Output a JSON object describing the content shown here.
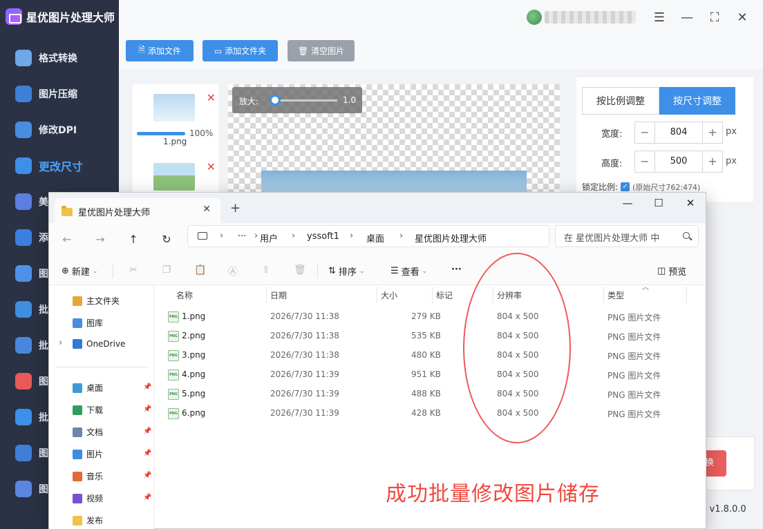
{
  "app": {
    "title": "星优图片处理大师",
    "version": "v1.8.0.0",
    "nav": [
      {
        "label": "格式转换",
        "color": "#6fa8e8"
      },
      {
        "label": "图片压缩",
        "color": "#3f7fd8"
      },
      {
        "label": "修改DPI",
        "color": "#4a8de0"
      },
      {
        "label": "更改尺寸",
        "color": "#3d8fe8"
      },
      {
        "label": "美",
        "color": "#5a7fe0"
      },
      {
        "label": "添",
        "color": "#3c7fe0"
      },
      {
        "label": "图",
        "color": "#4e92e8"
      },
      {
        "label": "批",
        "color": "#3f8fe0"
      },
      {
        "label": "批",
        "color": "#4a86df"
      },
      {
        "label": "图",
        "color": "#e85a5a"
      },
      {
        "label": "批",
        "color": "#3d8fe8"
      },
      {
        "label": "图",
        "color": "#3f7fd8"
      },
      {
        "label": "图",
        "color": "#5b86e0"
      }
    ],
    "toolbar": {
      "add_file": "添加文件",
      "add_folder": "添加文件夹",
      "clear": "清空图片"
    },
    "file_list": [
      {
        "name": "1.png",
        "progress_pct": 100,
        "progress_text": "100%"
      }
    ],
    "zoom": {
      "label": "放大:",
      "value": "1.0"
    },
    "settings": {
      "tab_ratio": "按比例调整",
      "tab_size": "按尺寸调整",
      "width_label": "宽度:",
      "width_value": "804",
      "height_label": "高度:",
      "height_value": "500",
      "unit": "px",
      "minus": "−",
      "plus": "+",
      "lock_label": "锁定比例:",
      "lock_hint": "(原始尺寸762:474)"
    },
    "convert_btn": "换",
    "version_prefix": ":"
  },
  "explorer": {
    "tab_title": "星优图片处理大师",
    "breadcrumb": [
      "用户",
      "yssoft1",
      "桌面",
      "星优图片处理大师"
    ],
    "search_placeholder": "在 星优图片处理大师 中",
    "commands": {
      "new": "新建",
      "sort": "排序",
      "view": "查看",
      "more": "···",
      "preview": "预览"
    },
    "nav": [
      {
        "label": "主文件夹",
        "pinned": false
      },
      {
        "label": "图库",
        "pinned": false
      },
      {
        "label": "OneDrive",
        "pinned": false
      },
      {
        "label": "桌面",
        "pinned": true
      },
      {
        "label": "下载",
        "pinned": true
      },
      {
        "label": "文档",
        "pinned": true
      },
      {
        "label": "图片",
        "pinned": true
      },
      {
        "label": "音乐",
        "pinned": true
      },
      {
        "label": "视频",
        "pinned": true
      },
      {
        "label": "发布",
        "pinned": false
      }
    ],
    "columns": [
      "名称",
      "日期",
      "大小",
      "标记",
      "分辨率",
      "类型"
    ],
    "files": [
      {
        "name": "1.png",
        "date": "2026/7/30 11:38",
        "size": "279 KB",
        "resolution": "804 x 500",
        "type": "PNG 图片文件"
      },
      {
        "name": "2.png",
        "date": "2026/7/30 11:38",
        "size": "535 KB",
        "resolution": "804 x 500",
        "type": "PNG 图片文件"
      },
      {
        "name": "3.png",
        "date": "2026/7/30 11:38",
        "size": "480 KB",
        "resolution": "804 x 500",
        "type": "PNG 图片文件"
      },
      {
        "name": "4.png",
        "date": "2026/7/30 11:39",
        "size": "951 KB",
        "resolution": "804 x 500",
        "type": "PNG 图片文件"
      },
      {
        "name": "5.png",
        "date": "2026/7/30 11:39",
        "size": "488 KB",
        "resolution": "804 x 500",
        "type": "PNG 图片文件"
      },
      {
        "name": "6.png",
        "date": "2026/7/30 11:39",
        "size": "428 KB",
        "resolution": "804 x 500",
        "type": "PNG 图片文件"
      }
    ]
  },
  "annotation": {
    "text": "成功批量修改图片储存",
    "color": "#f0483f"
  },
  "colors": {
    "accent": "#3d8fe8",
    "sidebar": "#2b3245",
    "danger": "#eb5e5e"
  }
}
